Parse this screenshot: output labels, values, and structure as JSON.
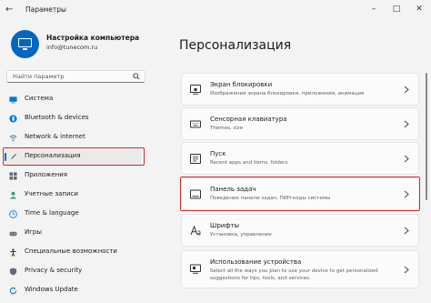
{
  "window": {
    "title": "Параметры"
  },
  "profile": {
    "name": "Настройка компьютера",
    "email": "info@tunecom.ru"
  },
  "search": {
    "placeholder": "Найти параметр"
  },
  "sidebar": {
    "items": [
      {
        "label": "Система",
        "icon": "system-icon"
      },
      {
        "label": "Bluetooth & devices",
        "icon": "bluetooth-icon"
      },
      {
        "label": "Network & internet",
        "icon": "network-icon"
      },
      {
        "label": "Персонализация",
        "icon": "brush-icon",
        "selected": true
      },
      {
        "label": "Приложения",
        "icon": "apps-icon"
      },
      {
        "label": "Учетные записи",
        "icon": "accounts-icon"
      },
      {
        "label": "Time & language",
        "icon": "globe-clock-icon"
      },
      {
        "label": "Игры",
        "icon": "gaming-icon"
      },
      {
        "label": "Специальные возможности",
        "icon": "accessibility-icon"
      },
      {
        "label": "Privacy & security",
        "icon": "shield-icon"
      },
      {
        "label": "Windows Update",
        "icon": "update-icon"
      }
    ]
  },
  "main": {
    "title": "Персонализация",
    "cards": [
      {
        "title": "Экран блокировки",
        "subtitle": "Изображения экрана блокировки, приложения, анимация",
        "icon": "lock-screen-icon"
      },
      {
        "title": "Сенсорная клавиатура",
        "subtitle": "Themes, size",
        "icon": "keyboard-icon"
      },
      {
        "title": "Пуск",
        "subtitle": "Recent apps and items, folders",
        "icon": "start-menu-icon"
      },
      {
        "title": "Панель задач",
        "subtitle": "Поведение панели задач, ПИН-коды системы",
        "icon": "taskbar-icon"
      },
      {
        "title": "Шрифты",
        "subtitle": "Установка, управление",
        "icon": "fonts-icon"
      },
      {
        "title": "Использование устройства",
        "subtitle": "Select all the ways you plan to use your device to get personalized",
        "subtitle2": "suggestions for tips, tools, and services.",
        "icon": "device-usage-icon"
      }
    ]
  },
  "colors": {
    "accent": "#0067c0",
    "highlight": "#d62828"
  }
}
